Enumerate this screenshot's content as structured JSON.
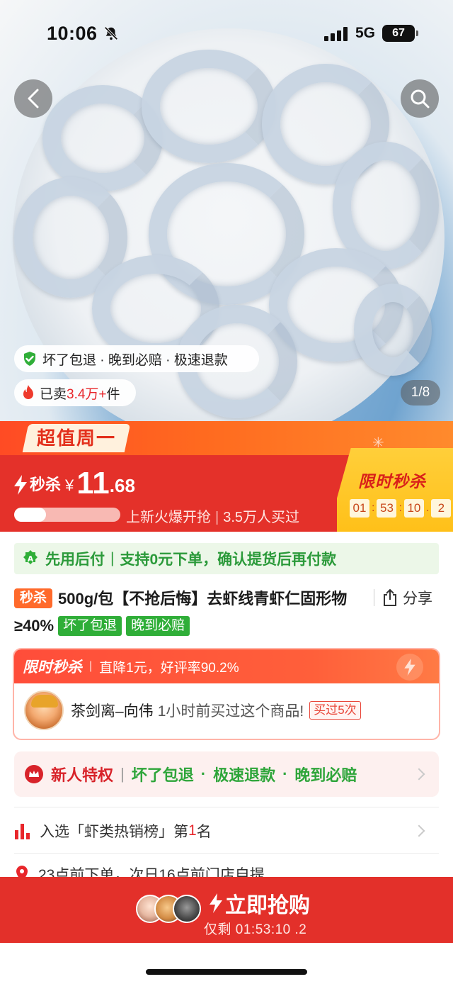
{
  "status_bar": {
    "time": "10:06",
    "network": "5G",
    "battery": "67"
  },
  "gallery": {
    "page_indicator": "1/8"
  },
  "badges": {
    "guarantee": "坏了包退 · 晚到必赔 · 极速退款",
    "sold_prefix": "已卖",
    "sold_count": "3.4万+",
    "sold_suffix": "件"
  },
  "promo": {
    "tag": "超值周一"
  },
  "sale": {
    "label": "秒杀",
    "currency": "¥",
    "price_int": "11",
    "price_dec": ".68",
    "progress": 0.3,
    "hot_text": "上新火爆开抢",
    "buyers_text": "3.5万人买过",
    "limited_title": "限时秒杀",
    "countdown": [
      "01",
      "53",
      "10",
      "2"
    ]
  },
  "pay_later": {
    "title": "先用后付",
    "detail": "支持0元下单，确认提货后再付款"
  },
  "product": {
    "tag": "秒杀",
    "title": "500g/包【不抢后悔】去虾线青虾仁固形物≥40%",
    "tags": [
      "坏了包退",
      "晚到必赔"
    ],
    "share_label": "分享"
  },
  "flash_card": {
    "title": "限时秒杀",
    "subtitle": "直降1元，好评率90.2%",
    "buyer_name": "茶剑离–向伟",
    "buyer_msg": "1小时前买过这个商品!",
    "bought_tag": "买过5次"
  },
  "newcomer": {
    "title": "新人特权",
    "items": [
      "坏了包退",
      "极速退款",
      "晚到必赔"
    ]
  },
  "ranking": {
    "prefix": "入选「虾类热销榜」第",
    "rank": "1",
    "suffix": "名"
  },
  "delivery": {
    "text": "23点前下单，次日16点前门店自提"
  },
  "bottom_bar": {
    "buy_label": "立即抢购",
    "remaining": "仅剩 01:53:10 .2"
  },
  "colors": {
    "brand_red": "#e3302a",
    "accent_orange": "#ff6a2b",
    "green": "#2fae38",
    "gold": "#ffc019"
  }
}
